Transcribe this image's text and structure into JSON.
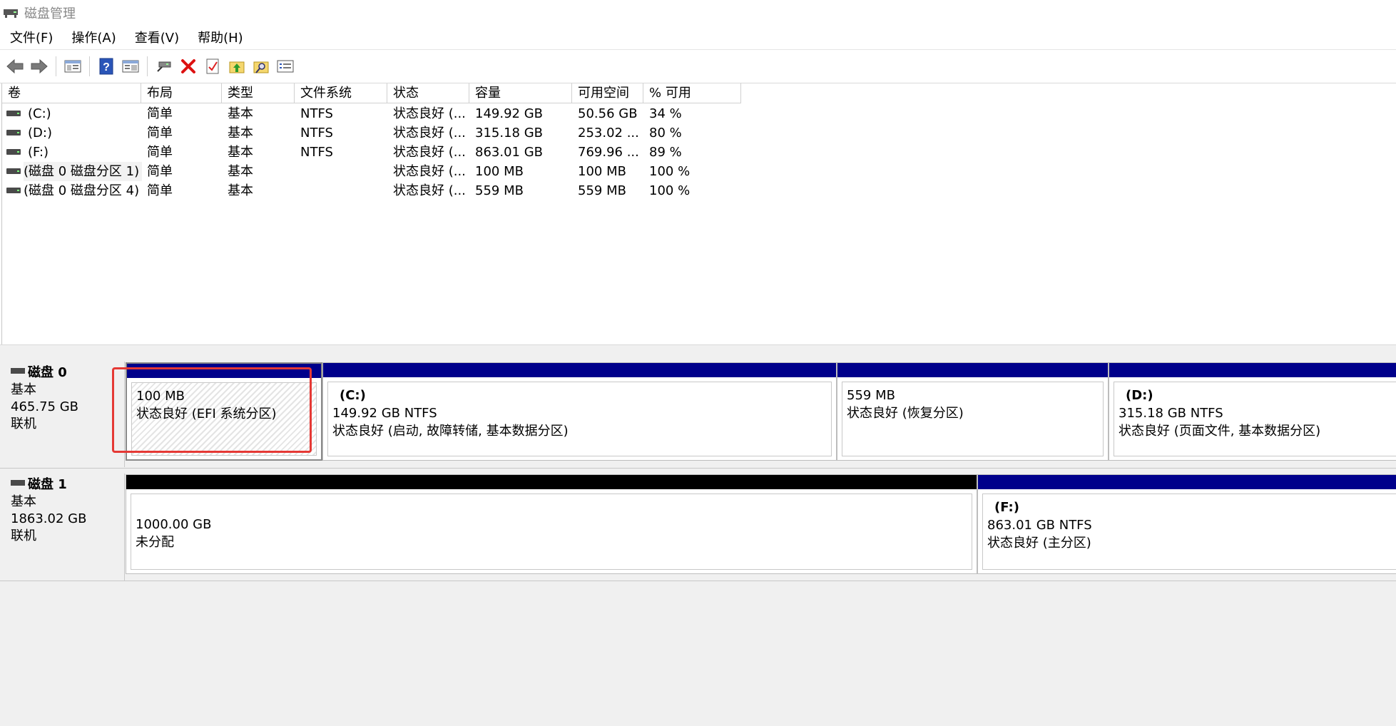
{
  "window": {
    "title": "磁盘管理"
  },
  "menu": [
    "文件(F)",
    "操作(A)",
    "查看(V)",
    "帮助(H)"
  ],
  "toolbar": [
    {
      "name": "back-arrow-icon"
    },
    {
      "name": "forward-arrow-icon"
    },
    {
      "name": "console-tree-icon"
    },
    {
      "name": "help-icon"
    },
    {
      "name": "properties-pane-icon"
    },
    {
      "name": "connect-disk-icon"
    },
    {
      "name": "delete-icon"
    },
    {
      "name": "checklist-icon"
    },
    {
      "name": "folder-up-icon"
    },
    {
      "name": "folder-search-icon"
    },
    {
      "name": "properties-icon"
    }
  ],
  "volume_list": {
    "columns": [
      "卷",
      "布局",
      "类型",
      "文件系统",
      "状态",
      "容量",
      "可用空间",
      "% 可用"
    ],
    "rows": [
      [
        "(C:)",
        "简单",
        "基本",
        "NTFS",
        "状态良好 (...",
        "149.92 GB",
        "50.56 GB",
        "34 %"
      ],
      [
        "(D:)",
        "简单",
        "基本",
        "NTFS",
        "状态良好 (...",
        "315.18 GB",
        "253.02 ...",
        "80 %"
      ],
      [
        "(F:)",
        "简单",
        "基本",
        "NTFS",
        "状态良好 (...",
        "863.01 GB",
        "769.96 ...",
        "89 %"
      ],
      [
        "(磁盘 0 磁盘分区 1)",
        "简单",
        "基本",
        "",
        "状态良好 (...",
        "100 MB",
        "100 MB",
        "100 %"
      ],
      [
        "(磁盘 0 磁盘分区 4)",
        "简单",
        "基本",
        "",
        "状态良好 (...",
        "559 MB",
        "559 MB",
        "100 %"
      ]
    ]
  },
  "disks": [
    {
      "name": "磁盘 0",
      "type": "基本",
      "size": "465.75 GB",
      "status": "联机",
      "partitions": [
        {
          "label": "",
          "size": "100 MB",
          "status": "状态良好 (EFI 系统分区)"
        },
        {
          "label": "(C:)",
          "size": "149.92 GB NTFS",
          "status": "状态良好 (启动, 故障转储, 基本数据分区)"
        },
        {
          "label": "",
          "size": "559 MB",
          "status": "状态良好 (恢复分区)"
        },
        {
          "label": "(D:)",
          "size": "315.18 GB NTFS",
          "status": "状态良好 (页面文件, 基本数据分区)"
        }
      ]
    },
    {
      "name": "磁盘 1",
      "type": "基本",
      "size": "1863.02 GB",
      "status": "联机",
      "partitions": [
        {
          "label": "",
          "size": "1000.00 GB",
          "status": "未分配"
        },
        {
          "label": "(F:)",
          "size": "863.01 GB NTFS",
          "status": "状态良好 (主分区)"
        }
      ]
    }
  ],
  "colors": {
    "primary_bar": "#00008b",
    "unallocated_bar": "#000000",
    "highlight": "#e53935"
  }
}
